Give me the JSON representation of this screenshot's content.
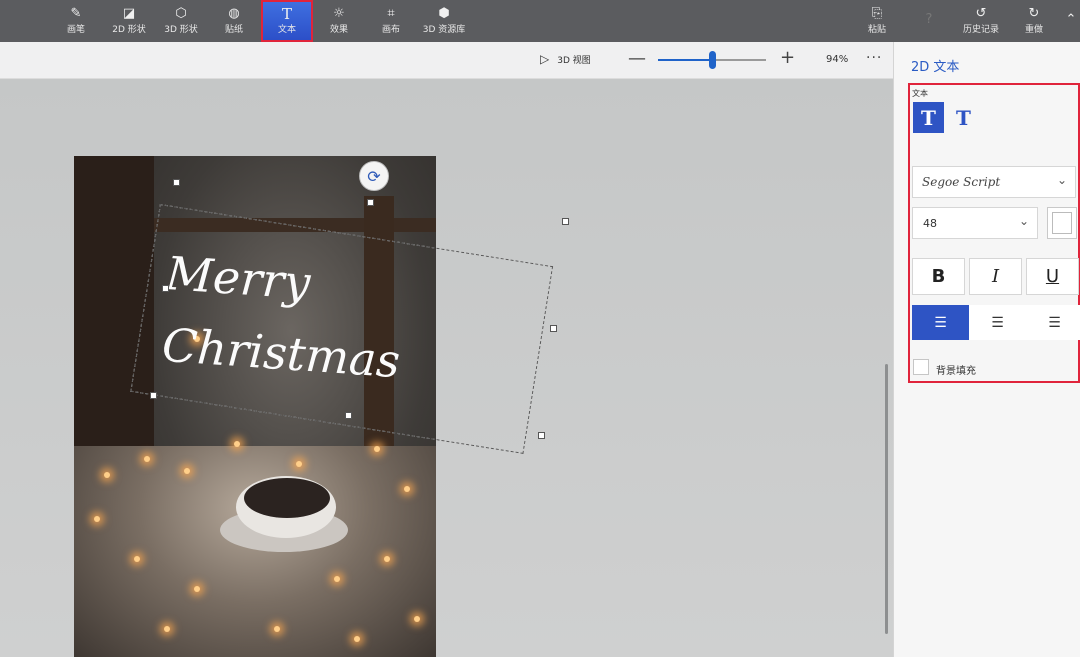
{
  "toolbar": {
    "left_tools": [
      {
        "label": "画笔",
        "icon": "brush-icon"
      },
      {
        "label": "2D 形状",
        "icon": "shape2d-icon"
      },
      {
        "label": "3D 形状",
        "icon": "shape3d-icon"
      },
      {
        "label": "贴纸",
        "icon": "sticker-icon"
      },
      {
        "label": "文本",
        "icon": "text-icon",
        "active": true
      },
      {
        "label": "效果",
        "icon": "effects-icon"
      },
      {
        "label": "画布",
        "icon": "canvas-icon"
      },
      {
        "label": "3D 资源库",
        "icon": "library3d-icon"
      }
    ],
    "right_tools": [
      {
        "label": "粘贴",
        "icon": "paste-icon"
      },
      {
        "label": "",
        "icon": "help-icon",
        "disabled": true
      },
      {
        "label": "历史记录",
        "icon": "history-icon"
      },
      {
        "label": "重做",
        "icon": "redo-icon"
      }
    ]
  },
  "subbar": {
    "view3d_label": "3D 视图",
    "zoom_minus": "—",
    "zoom_plus": "+",
    "zoom_value": "94%",
    "zoom_level": 0.5,
    "more": "···"
  },
  "canvas": {
    "text_line1": "Merry",
    "text_line2": "Christmas"
  },
  "panel": {
    "title": "2D 文本",
    "section_label": "文本",
    "font_name": "Segoe Script",
    "font_size": "48",
    "text_color": "#ffffff",
    "bold_label": "B",
    "italic_label": "I",
    "underline_label": "U",
    "bg_fill_label": "背景填充"
  },
  "accent_color": "#2e54c4"
}
